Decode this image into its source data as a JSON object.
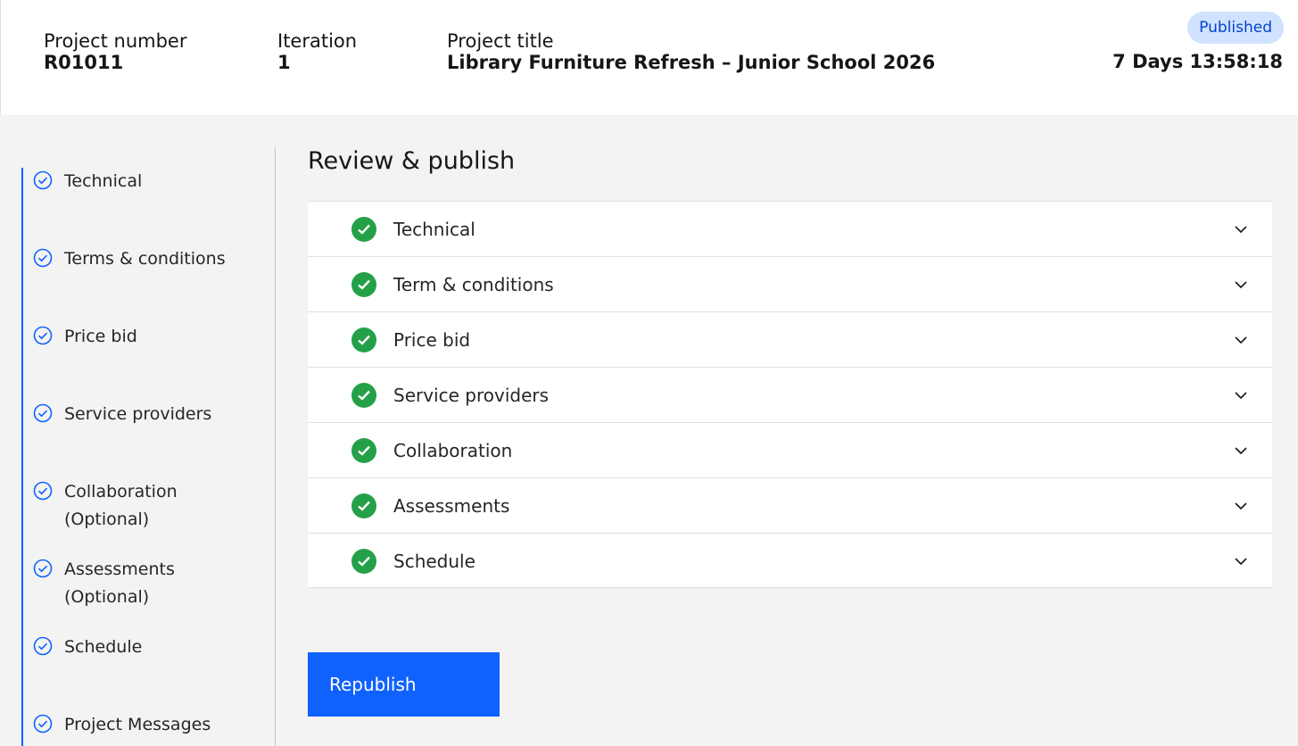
{
  "header": {
    "project_number_label": "Project number",
    "project_number": "R01011",
    "iteration_label": "Iteration",
    "iteration": "1",
    "project_title_label": "Project title",
    "project_title": "Library Furniture Refresh – Junior School 2026",
    "status_badge": "Published",
    "countdown": "7 Days 13:58:18"
  },
  "sidebar": {
    "items": [
      {
        "label": "Technical",
        "icon": "check-circle-outline-icon"
      },
      {
        "label": "Terms & conditions",
        "icon": "check-circle-outline-icon"
      },
      {
        "label": "Price bid",
        "icon": "check-circle-outline-icon"
      },
      {
        "label": "Service providers",
        "icon": "check-circle-outline-icon"
      },
      {
        "label": "Collaboration\n(Optional)",
        "icon": "check-circle-outline-icon"
      },
      {
        "label": "Assessments\n(Optional)",
        "icon": "check-circle-outline-icon"
      },
      {
        "label": "Schedule",
        "icon": "check-circle-outline-icon"
      },
      {
        "label": "Project Messages",
        "icon": "check-circle-outline-icon"
      }
    ]
  },
  "main": {
    "title": "Review & publish",
    "sections": [
      {
        "label": "Technical",
        "icon": "check-filled-icon"
      },
      {
        "label": "Term & conditions",
        "icon": "check-filled-icon"
      },
      {
        "label": "Price bid",
        "icon": "check-filled-icon"
      },
      {
        "label": "Service providers",
        "icon": "check-filled-icon"
      },
      {
        "label": "Collaboration",
        "icon": "check-filled-icon"
      },
      {
        "label": "Assessments",
        "icon": "check-filled-icon"
      },
      {
        "label": "Schedule",
        "icon": "check-filled-icon"
      }
    ],
    "republish_label": "Republish"
  },
  "colors": {
    "accent": "#0f62fe",
    "success": "#24a148",
    "badge_bg": "#d0e2ff",
    "badge_text": "#0043ce"
  }
}
